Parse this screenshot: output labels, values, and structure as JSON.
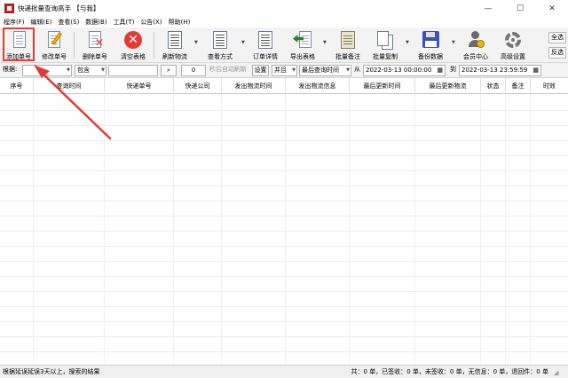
{
  "window": {
    "title": "快递批量查询高手 【与我】",
    "controls": [
      "—",
      "☐",
      "✕"
    ]
  },
  "menu": [
    {
      "label": "程序(F)"
    },
    {
      "label": "编辑(E)"
    },
    {
      "label": "查看(S)"
    },
    {
      "label": "数据(B)"
    },
    {
      "label": "工具(T)"
    },
    {
      "label": "公告(X)"
    },
    {
      "label": "帮助(H)"
    }
  ],
  "toolbar": {
    "add": "添加单号",
    "edit": "修改单号",
    "delete": "删除单号",
    "clear": "清空表格",
    "refresh": "刷新物流",
    "view_mode": "查看方式",
    "order_detail": "订单详情",
    "export": "导出表格",
    "batch_note": "批量备注",
    "batch_copy": "批量复制",
    "backup": "备份数据",
    "member": "会员中心",
    "advanced": "高级设置",
    "select_all": "全选",
    "invert": "反选",
    "highlighted_button": "添加单号"
  },
  "filter": {
    "basis_label": "根据:",
    "basis_value": "",
    "match_value": "包含",
    "keyword_value": "",
    "seconds_value": "0",
    "auto_refresh_label": "秒后自动刷新",
    "settings_button": "设置",
    "logic_value": "并且",
    "time_field_value": "最后查询时间",
    "from_label": "从",
    "from_value": "2022-03-13 00:00:00",
    "to_label": "到",
    "to_value": "2022-03-13 23:59:59"
  },
  "table": {
    "columns": [
      "序号",
      "查询时间",
      "快递单号",
      "快递公司",
      "发出物流时间",
      "发出物流信息",
      "最后更新时间",
      "最后更新物流",
      "状态",
      "备注",
      "时效"
    ]
  },
  "status": {
    "left": "根据延误延误3天以上，搜索的结果",
    "total_label": "共：",
    "total": "0",
    "signed_label": "单，已签收：",
    "signed": "0",
    "unsigned_label": "单，未签收：",
    "unsigned": "0",
    "noinfo_label": "单，无信息：",
    "noinfo": "0",
    "returned_label": "单，退回件：",
    "returned": "0",
    "unit": "单"
  },
  "colors": {
    "highlight": "#e53935",
    "toolbar_bg": "#f3f3f3"
  }
}
